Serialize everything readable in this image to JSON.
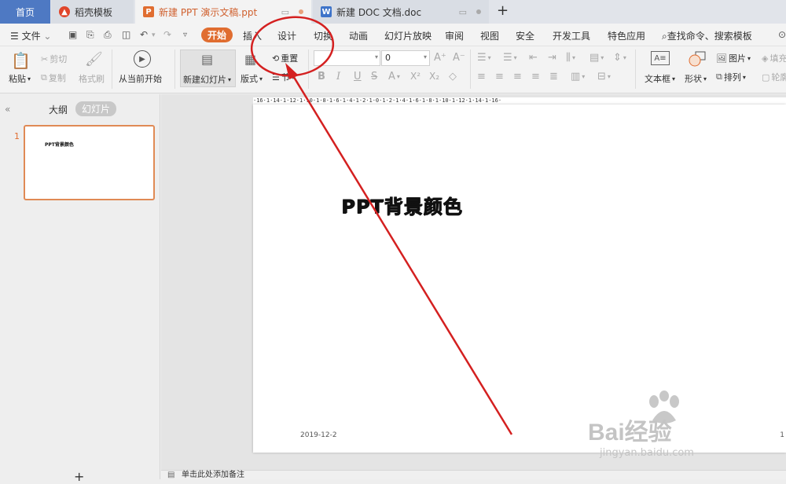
{
  "tabs": {
    "home": "首页",
    "templates": "稻壳模板",
    "ppt": "新建 PPT 演示文稿.ppt",
    "doc": "新建 DOC 文档.doc",
    "add": "+"
  },
  "menu": {
    "file": "文件",
    "items": [
      "开始",
      "插入",
      "设计",
      "切换",
      "动画",
      "幻灯片放映",
      "审阅",
      "视图",
      "安全",
      "开发工具",
      "特色应用"
    ],
    "search": "查找命令、搜索模板"
  },
  "ribbon": {
    "paste": "粘贴",
    "cut": "剪切",
    "copy": "复制",
    "format_painter": "格式刷",
    "from_start": "从当前开始",
    "new_slide": "新建幻灯片",
    "layout": "版式",
    "reset": "重置",
    "section": "节",
    "font_size_value": "0",
    "textbox": "文本框",
    "shape": "形状",
    "picture": "图片",
    "arrange": "排列",
    "fill": "填充",
    "outline": "轮廓"
  },
  "panel": {
    "outline": "大纲",
    "slides": "幻灯片",
    "slide_number": "1",
    "thumb_title": "PPT背景颜色",
    "add": "+"
  },
  "ruler_text": "·16·1·14·1·12·1·10·1·8·1·6·1·4·1·2·1·0·1·2·1·4·1·6·1·8·1·10·1·12·1·14·1·16·",
  "slide": {
    "title": "PPT背景颜色",
    "date": "2019-12-2",
    "number": "1"
  },
  "status": {
    "notes": "单击此处添加备注"
  },
  "watermark": {
    "brand": "Bai经验",
    "url": "jingyan.baidu.com"
  },
  "colors": {
    "accent": "#e06d30",
    "home_tab": "#4e79c3",
    "annotation": "#d42020"
  }
}
